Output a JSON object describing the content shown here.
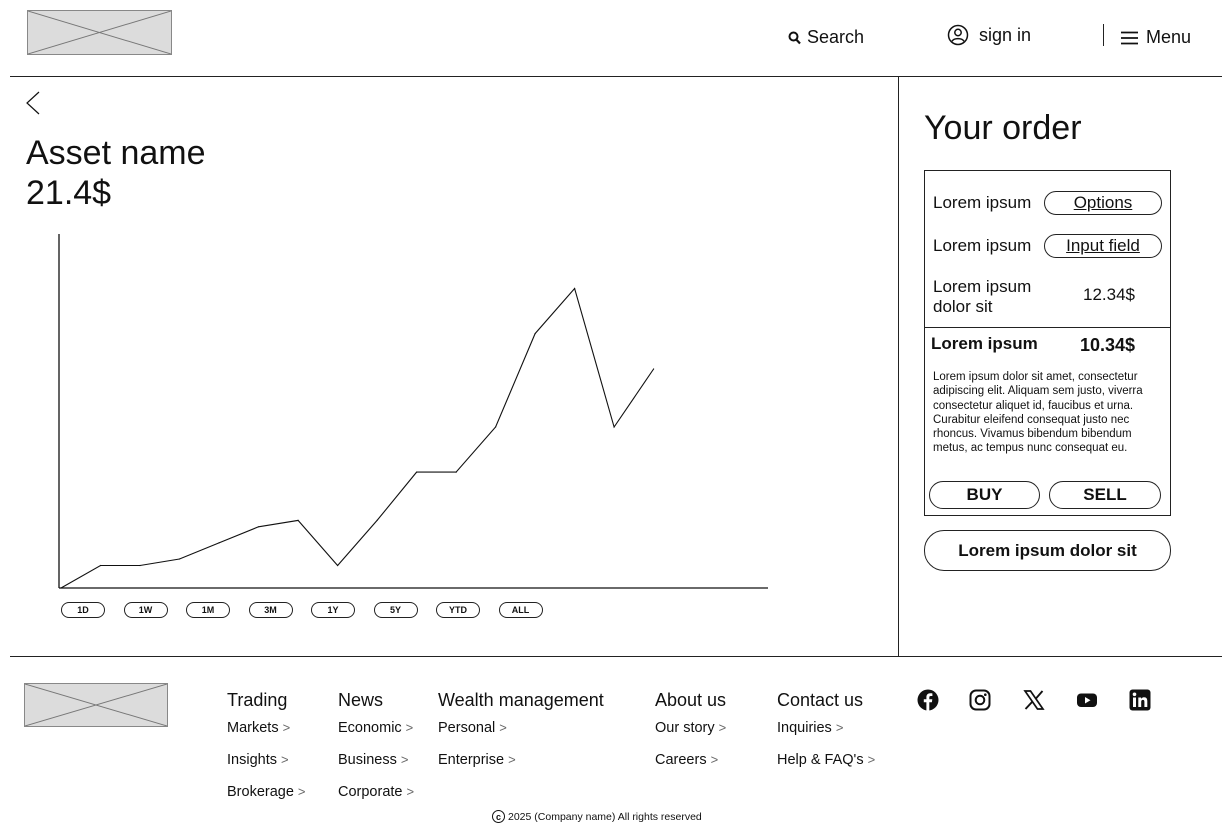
{
  "header": {
    "search_label": "Search",
    "signin_label": "sign in",
    "menu_label": "Menu"
  },
  "asset": {
    "back_icon": "chevron-left-icon",
    "name": "Asset name",
    "price": "21.4$"
  },
  "chart_data": {
    "type": "line",
    "x": [
      0,
      1,
      2,
      3,
      4,
      5,
      6,
      7,
      8,
      9,
      10,
      11,
      12,
      13,
      14,
      15,
      16,
      17
    ],
    "values": [
      0,
      7,
      7,
      9,
      14,
      19,
      21,
      7,
      21,
      36,
      36,
      50,
      79,
      93,
      50,
      68
    ],
    "xlim": [
      0,
      17
    ],
    "ylim": [
      0,
      100
    ],
    "grid": false
  },
  "ranges": [
    "1D",
    "1W",
    "1M",
    "3M",
    "1Y",
    "5Y",
    "YTD",
    "ALL"
  ],
  "order": {
    "title": "Your order",
    "rows": [
      {
        "label": "Lorem ipsum",
        "control": "Options"
      },
      {
        "label": "Lorem ipsum",
        "control": "Input field"
      },
      {
        "label_line1": "Lorem ipsum",
        "label_line2": "dolor sit",
        "value": "12.34$"
      }
    ],
    "total_label": "Lorem ipsum",
    "total_value": "10.34$",
    "description": "Lorem ipsum dolor sit amet, consectetur adipiscing elit. Aliquam sem justo, viverra consectetur aliquet id, faucibus et urna. Curabitur eleifend consequat justo nec rhoncus. Vivamus bibendum bibendum metus, ac tempus nunc consequat eu.",
    "buy_label": "BUY",
    "sell_label": "SELL",
    "cta_label": "Lorem ipsum dolor sit"
  },
  "footer": {
    "columns": [
      {
        "heading": "Trading",
        "links": [
          "Markets",
          "Insights",
          "Brokerage"
        ]
      },
      {
        "heading": "News",
        "links": [
          "Economic",
          "Business",
          "Corporate"
        ]
      },
      {
        "heading": "Wealth management",
        "links": [
          "Personal",
          "Enterprise"
        ]
      },
      {
        "heading": "About us",
        "links": [
          "Our story",
          "Careers"
        ]
      },
      {
        "heading": "Contact us",
        "links": [
          "Inquiries",
          "Help & FAQ's"
        ]
      }
    ],
    "chevron": ">",
    "social_icons": [
      "facebook-icon",
      "instagram-icon",
      "x-icon",
      "youtube-icon",
      "linkedin-icon"
    ],
    "copyright_symbol": "c",
    "copyright_text": "2025 (Company name) All rights reserved"
  }
}
